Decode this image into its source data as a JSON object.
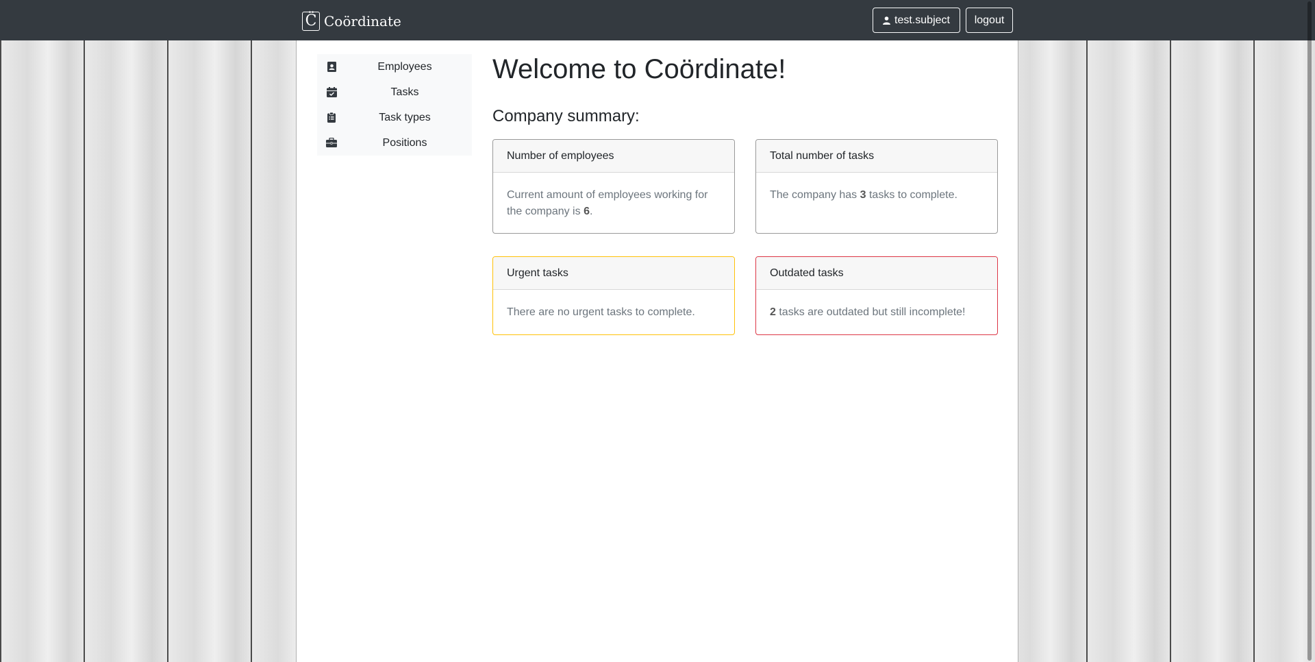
{
  "navbar": {
    "brand_logo": "C̈",
    "brand_name": "Coördinate",
    "user_label": "test.subject",
    "logout_label": "logout"
  },
  "sidebar": {
    "items": [
      {
        "label": "Employees",
        "icon": "address-card-icon"
      },
      {
        "label": "Tasks",
        "icon": "calendar-check-icon"
      },
      {
        "label": "Task types",
        "icon": "clipboard-list-icon"
      },
      {
        "label": "Positions",
        "icon": "briefcase-icon"
      }
    ]
  },
  "main": {
    "welcome": "Welcome to Coördinate!",
    "summary_title": "Company summary:",
    "cards": {
      "employees": {
        "title": "Number of employees",
        "text_before": "Current amount of employees working for the company is ",
        "value": "6",
        "text_after": "."
      },
      "tasks": {
        "title": "Total number of tasks",
        "text_before": "The company has ",
        "value": "3",
        "text_after": " tasks to complete."
      },
      "urgent": {
        "title": "Urgent tasks",
        "text": "There are no urgent tasks to complete."
      },
      "outdated": {
        "title": "Outdated tasks",
        "value": "2",
        "text_after": " tasks are outdated but still incomplete!"
      }
    }
  },
  "colors": {
    "navbar": "#343a40",
    "urgent_border": "#ffc107",
    "outdated_border": "#dc3545"
  }
}
